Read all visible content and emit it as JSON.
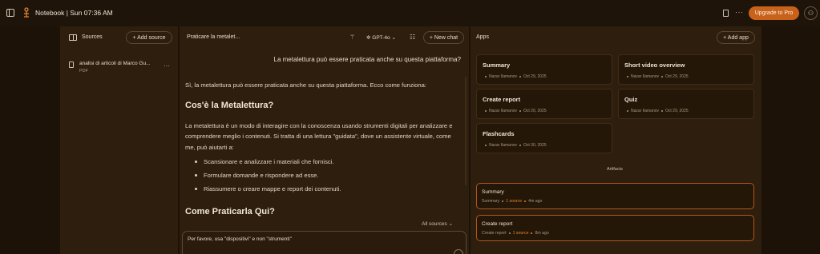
{
  "topbar": {
    "title": "Notebook | Sun 07:36 AM",
    "upgrade_label": "Upgrade to Pro",
    "more_label": "···"
  },
  "sources": {
    "header": "Sources",
    "add_label": "+ Add source",
    "items": [
      {
        "name": "analisi di articoli di Marco Gu...",
        "type": "PDF"
      }
    ]
  },
  "chat": {
    "title": "Praticare la metalet...",
    "model": "GPT-4o",
    "new_chat_label": "+ New chat",
    "user_message": "La metalettura può essere praticata anche su questa piattaforma?",
    "answer_intro": "Sì, la metalettura può essere praticata anche su questa piattaforma. Ecco come funziona:",
    "heading_1": "Cos'è la Metalettura?",
    "paragraph_1": "La metalettura è un modo di interagire con la conoscenza usando strumenti digitali per analizzare e comprendere meglio i contenuti. Si tratta di una lettura \"guidata\", dove un assistente virtuale, come me, può aiutarti a:",
    "bullets": [
      "Scansionare e analizzare i materiali che fornisci.",
      "Formulare domande e rispondere ad esse.",
      "Riassumere o creare mappe e report dei contenuti."
    ],
    "heading_2": "Come Praticarla Qui?",
    "all_sources_label": "All sources",
    "input_value": "Per favore, usa \"dispositivi\" e non \"strumenti\""
  },
  "apps": {
    "header": "Apps",
    "add_label": "+ Add app",
    "cards": [
      {
        "title": "Summary",
        "author": "Nazar Ilamanov",
        "date": "Oct 29, 2025"
      },
      {
        "title": "Short video overview",
        "author": "Nazar Ilamanov",
        "date": "Oct 29, 2025"
      },
      {
        "title": "Create report",
        "author": "Nazar Ilamanov",
        "date": "Oct 20, 2025"
      },
      {
        "title": "Quiz",
        "author": "Nazar Ilamanov",
        "date": "Oct 29, 2025"
      },
      {
        "title": "Flashcards",
        "author": "Nazar Ilamanov",
        "date": "Oct 30, 2025"
      }
    ],
    "artifacts_label": "Artifacts",
    "artifacts": [
      {
        "title": "Summary",
        "kind": "Summary",
        "sources": "1 source",
        "age": "4m ago"
      },
      {
        "title": "Create report",
        "kind": "Create report",
        "sources": "1 source",
        "age": "8m ago"
      }
    ]
  },
  "colors": {
    "accent": "#c8621b",
    "background": "#1c1208",
    "panel": "#2e1e0d"
  }
}
